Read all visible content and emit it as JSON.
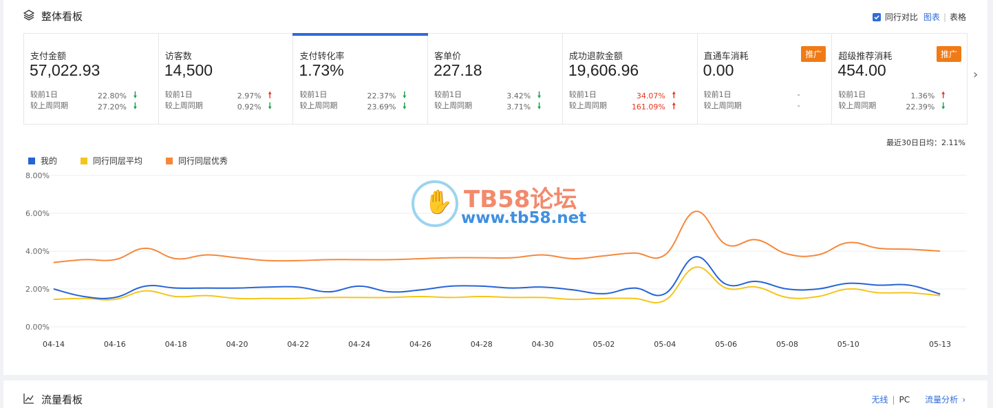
{
  "panel": {
    "title": "整体看板",
    "compare_label": "同行对比",
    "view_chart": "图表",
    "view_table": "表格",
    "avg_label": "最近30日日均：2.11%"
  },
  "metrics": [
    {
      "name": "支付金额",
      "value": "57,022.93",
      "r1_label": "较前1日",
      "r1_pct": "22.80%",
      "r1_dir": "down",
      "r2_label": "较上周同期",
      "r2_pct": "27.20%",
      "r2_dir": "down"
    },
    {
      "name": "访客数",
      "value": "14,500",
      "r1_label": "较前1日",
      "r1_pct": "2.97%",
      "r1_dir": "up",
      "r2_label": "较上周同期",
      "r2_pct": "0.92%",
      "r2_dir": "down"
    },
    {
      "name": "支付转化率",
      "value": "1.73%",
      "r1_label": "较前1日",
      "r1_pct": "22.37%",
      "r1_dir": "down",
      "r2_label": "较上周同期",
      "r2_pct": "23.69%",
      "r2_dir": "down"
    },
    {
      "name": "客单价",
      "value": "227.18",
      "r1_label": "较前1日",
      "r1_pct": "3.42%",
      "r1_dir": "down",
      "r2_label": "较上周同期",
      "r2_pct": "3.71%",
      "r2_dir": "down"
    },
    {
      "name": "成功退款金额",
      "value": "19,606.96",
      "r1_label": "较前1日",
      "r1_pct": "34.07%",
      "r1_dir": "up",
      "r2_label": "较上周同期",
      "r2_pct": "161.09%",
      "r2_dir": "up",
      "red": true
    },
    {
      "name": "直通车消耗",
      "value": "0.00",
      "r1_label": "较前1日",
      "r1_pct": "-",
      "r1_dir": "none",
      "r2_label": "较上周同期",
      "r2_pct": "-",
      "r2_dir": "none",
      "promo": "推广"
    },
    {
      "name": "超级推荐消耗",
      "value": "454.00",
      "r1_label": "较前1日",
      "r1_pct": "1.36%",
      "r1_dir": "up",
      "r2_label": "较上周同期",
      "r2_pct": "22.39%",
      "r2_dir": "down",
      "promo": "推广"
    }
  ],
  "legend": [
    {
      "name": "我的",
      "color": "#2563d6"
    },
    {
      "name": "同行同层平均",
      "color": "#f5c518"
    },
    {
      "name": "同行同层优秀",
      "color": "#f7873a"
    }
  ],
  "watermark": {
    "title": "TB58论坛",
    "url": "www.tb58.net"
  },
  "panel2": {
    "title": "流量看板",
    "wireless": "无线",
    "pc": "PC",
    "analysis": "流量分析"
  },
  "chart_data": {
    "type": "line",
    "x": [
      "04-14",
      "04-15",
      "04-16",
      "04-17",
      "04-18",
      "04-19",
      "04-20",
      "04-21",
      "04-22",
      "04-23",
      "04-24",
      "04-25",
      "04-26",
      "04-27",
      "04-28",
      "04-29",
      "04-30",
      "05-01",
      "05-02",
      "05-03",
      "05-04",
      "05-05",
      "05-06",
      "05-07",
      "05-08",
      "05-09",
      "05-10",
      "05-11",
      "05-12",
      "05-13"
    ],
    "x_tick_labels": [
      "04-14",
      "04-16",
      "04-18",
      "04-20",
      "04-22",
      "04-24",
      "04-26",
      "04-28",
      "04-30",
      "05-02",
      "05-04",
      "05-06",
      "05-08",
      "05-10",
      "05-13"
    ],
    "ylim": [
      0,
      8
    ],
    "y_ticks": [
      "0.00%",
      "2.00%",
      "4.00%",
      "6.00%",
      "8.00%"
    ],
    "series": [
      {
        "name": "我的",
        "color": "#2563d6",
        "values": [
          2.0,
          1.6,
          1.55,
          2.15,
          2.05,
          2.05,
          2.05,
          2.1,
          2.1,
          1.85,
          2.15,
          1.85,
          1.95,
          2.15,
          2.15,
          2.05,
          2.1,
          1.95,
          1.75,
          2.05,
          1.75,
          3.7,
          2.25,
          2.4,
          2.0,
          2.0,
          2.3,
          2.2,
          2.2,
          1.73
        ]
      },
      {
        "name": "同行同层平均",
        "color": "#f5c518",
        "values": [
          1.45,
          1.5,
          1.45,
          1.9,
          1.6,
          1.65,
          1.5,
          1.5,
          1.5,
          1.55,
          1.55,
          1.55,
          1.6,
          1.55,
          1.6,
          1.55,
          1.55,
          1.45,
          1.5,
          1.5,
          1.4,
          3.15,
          2.05,
          2.1,
          1.55,
          1.6,
          2.0,
          1.8,
          1.8,
          1.65
        ]
      },
      {
        "name": "同行同层优秀",
        "color": "#f7873a",
        "values": [
          3.4,
          3.55,
          3.55,
          4.15,
          3.6,
          3.8,
          3.65,
          3.5,
          3.5,
          3.55,
          3.55,
          3.55,
          3.6,
          3.65,
          3.65,
          3.65,
          3.8,
          3.6,
          3.75,
          3.9,
          3.8,
          6.1,
          4.35,
          4.6,
          3.85,
          3.8,
          4.45,
          4.15,
          4.1,
          4.0
        ]
      }
    ]
  }
}
